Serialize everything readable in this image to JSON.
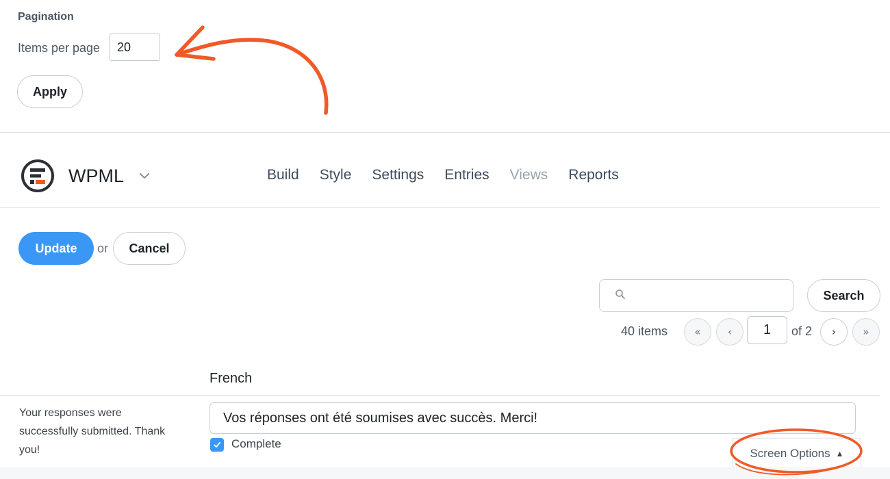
{
  "pagination": {
    "section_title": "Pagination",
    "items_per_page_label": "Items per page",
    "items_per_page_value": "20",
    "apply_label": "Apply"
  },
  "header": {
    "form_name": "WPML",
    "nav": [
      {
        "label": "Build",
        "active": false
      },
      {
        "label": "Style",
        "active": false
      },
      {
        "label": "Settings",
        "active": false
      },
      {
        "label": "Entries",
        "active": false
      },
      {
        "label": "Views",
        "active": true
      },
      {
        "label": "Reports",
        "active": false
      }
    ]
  },
  "actions": {
    "update_label": "Update",
    "or_text": "or",
    "cancel_label": "Cancel"
  },
  "search": {
    "placeholder": "",
    "button_label": "Search"
  },
  "pager": {
    "items_count": "40 items",
    "first": "«",
    "prev": "‹",
    "current_page": "1",
    "of_text": "of 2",
    "next": "›",
    "last": "»"
  },
  "table": {
    "column_header": "French",
    "row": {
      "original": "Your responses were successfully submitted. Thank you!",
      "translation": "Vos réponses ont été soumises avec succès. Merci!",
      "complete_label": "Complete",
      "complete_checked": true
    }
  },
  "screen_options": {
    "label": "Screen Options",
    "arrow": "▲"
  },
  "colors": {
    "primary": "#3b97f6",
    "annotation": "#f05a28"
  }
}
